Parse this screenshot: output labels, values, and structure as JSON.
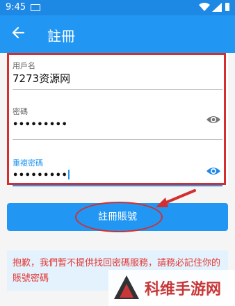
{
  "status": {
    "time": "9:45"
  },
  "appbar": {
    "title": "註冊"
  },
  "form": {
    "username": {
      "label": "用戶名",
      "value": "7273资源网"
    },
    "password": {
      "label": "密碼",
      "value": "•••••••••"
    },
    "confirm": {
      "label": "重複密碼",
      "value": "•••••••••"
    }
  },
  "register_button": {
    "label": "註冊賬號"
  },
  "notice": {
    "text": "抱歉，我們暫不提供找回密碼服務，請務必記住你的賬號密碼"
  },
  "watermark": {
    "text": "科维手游网"
  },
  "colors": {
    "primary": "#2196f3",
    "annotation": "#d32f2f"
  }
}
